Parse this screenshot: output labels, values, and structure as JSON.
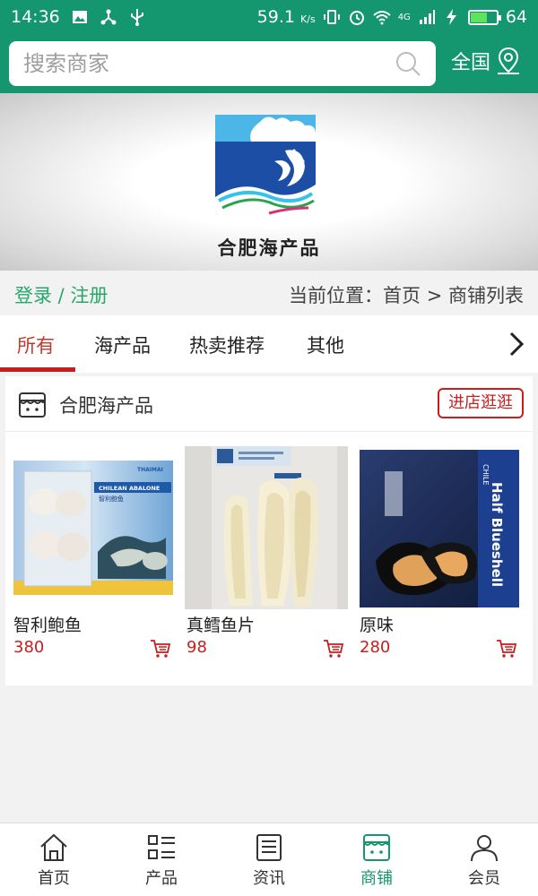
{
  "status_bar": {
    "time": "14:36",
    "speed": "59.1",
    "speed_unit": "K/s",
    "network": "4G",
    "battery": "64",
    "battery_level": 0.64
  },
  "header": {
    "search_placeholder": "搜索商家",
    "region": "全国"
  },
  "banner": {
    "logo_text": "合肥海产品"
  },
  "infobar": {
    "login_link": "登录 / 注册",
    "breadcrumb": "当前位置：首页 > 商铺列表"
  },
  "tabs": [
    {
      "label": "所有",
      "active": true
    },
    {
      "label": "海产品"
    },
    {
      "label": "热卖推荐"
    },
    {
      "label": "其他"
    }
  ],
  "shop": {
    "name": "合肥海产品",
    "visit_label": "进店逛逛",
    "products": [
      {
        "name": "智利鲍鱼",
        "price": "380",
        "package_text": "CHILEAN ABALONE",
        "package_subtext": "智利鲍鱼",
        "brand": "THAIMAI"
      },
      {
        "name": "真鳕鱼片",
        "price": "98"
      },
      {
        "name": "原味",
        "price": "280",
        "package_text": "Half Blueshell",
        "package_subtext": "CHILE"
      }
    ]
  },
  "bottom_nav": [
    {
      "label": "首页",
      "icon": "home-icon"
    },
    {
      "label": "产品",
      "icon": "list-icon"
    },
    {
      "label": "资讯",
      "icon": "news-icon"
    },
    {
      "label": "商铺",
      "icon": "store-icon",
      "active": true
    },
    {
      "label": "会员",
      "icon": "user-icon"
    }
  ],
  "colors": {
    "brand": "#14966e",
    "accent": "#c81e1e",
    "login": "#27a86b"
  }
}
